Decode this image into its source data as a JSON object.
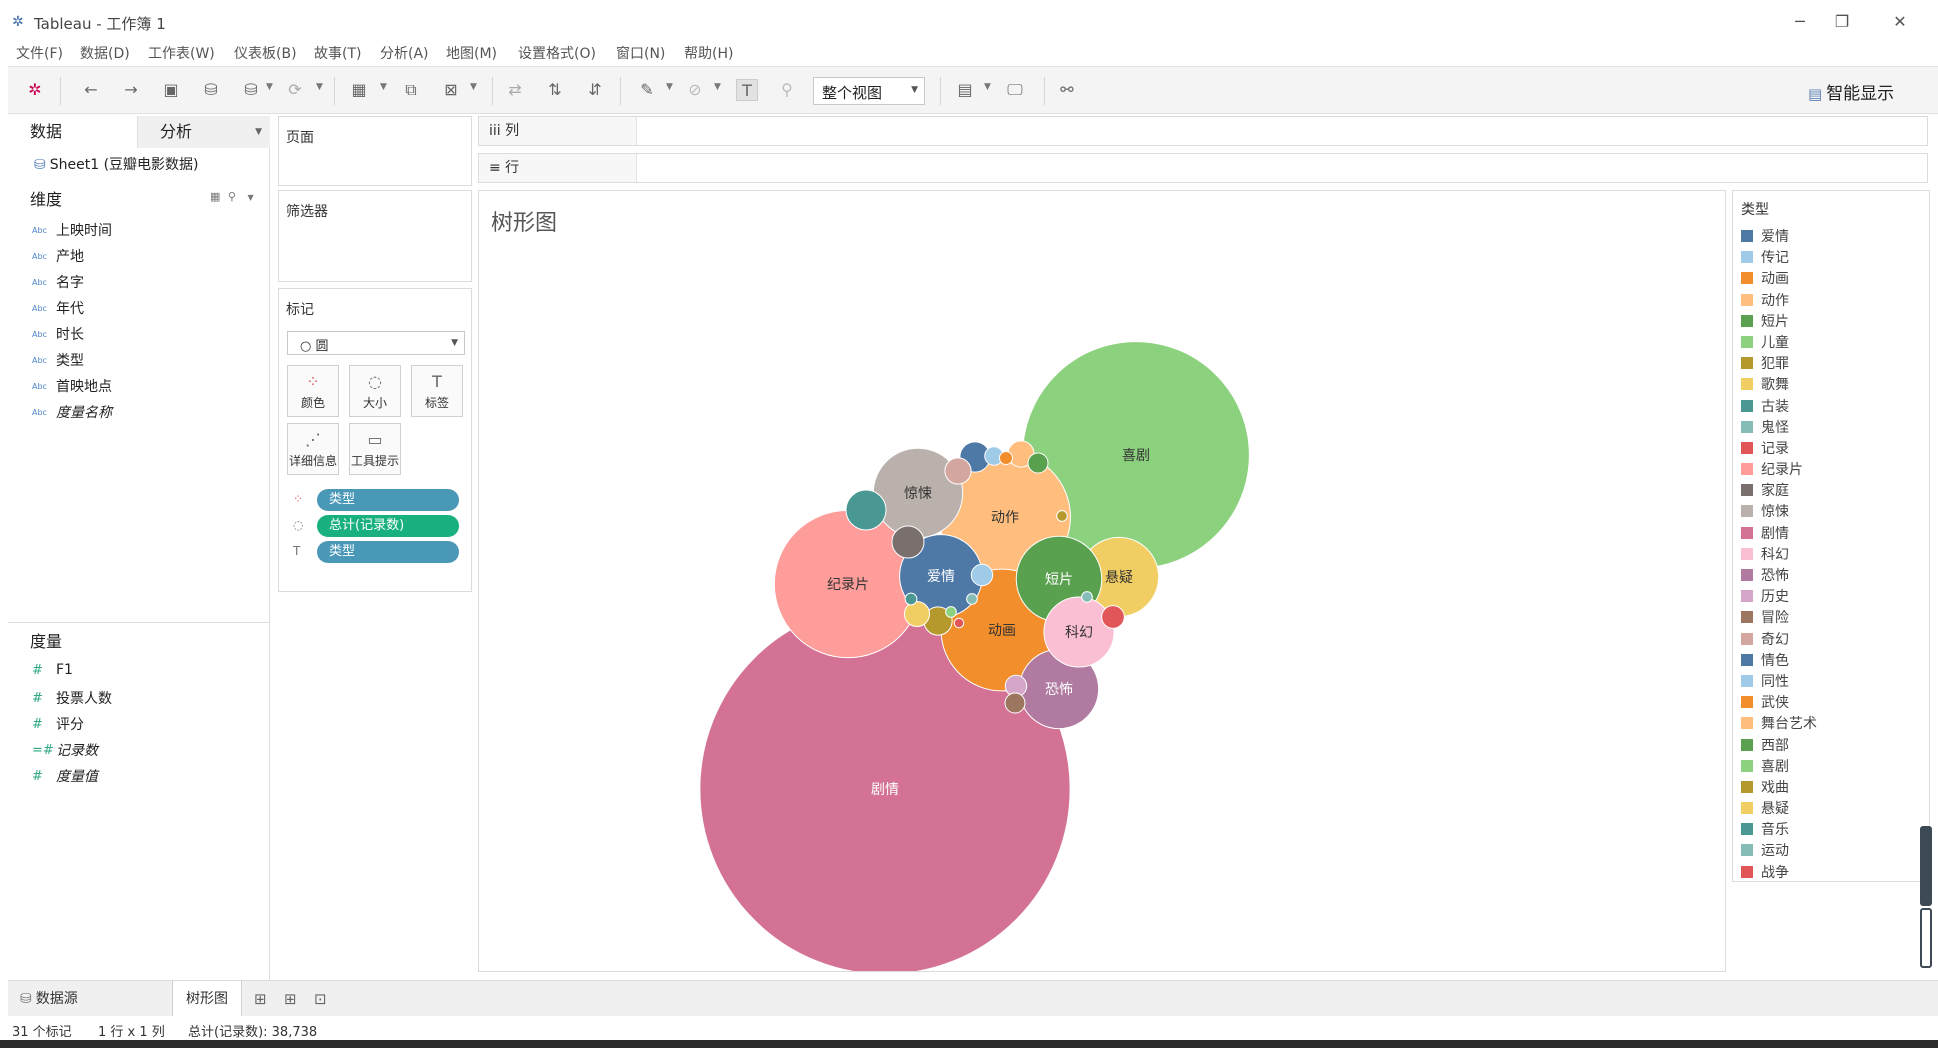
{
  "window": {
    "title": "Tableau - 工作簿 1",
    "minimize": "─",
    "restore": "❐",
    "close": "✕"
  },
  "menu": [
    "文件(F)",
    "数据(D)",
    "工作表(W)",
    "仪表板(B)",
    "故事(T)",
    "分析(A)",
    "地图(M)",
    "设置格式(O)",
    "窗口(N)",
    "帮助(H)"
  ],
  "toolbar": {
    "view_mode": "整个视图",
    "smart_show": "智能显示"
  },
  "data_pane": {
    "tab_data": "数据",
    "tab_analysis": "分析",
    "datasource": "Sheet1 (豆瓣电影数据)",
    "dimensions_header": "维度",
    "dimensions": [
      {
        "type": "Abc",
        "name": "上映时间"
      },
      {
        "type": "Abc",
        "name": "产地"
      },
      {
        "type": "Abc",
        "name": "名字"
      },
      {
        "type": "Abc",
        "name": "年代"
      },
      {
        "type": "Abc",
        "name": "时长"
      },
      {
        "type": "Abc",
        "name": "类型"
      },
      {
        "type": "Abc",
        "name": "首映地点"
      },
      {
        "type": "Abc",
        "name": "度量名称"
      }
    ],
    "measures_header": "度量",
    "measures": [
      {
        "type": "#",
        "name": "F1"
      },
      {
        "type": "#",
        "name": "投票人数"
      },
      {
        "type": "#",
        "name": "评分"
      },
      {
        "type": "=#",
        "name": "记录数"
      },
      {
        "type": "#",
        "name": "度量值"
      }
    ]
  },
  "cards": {
    "pages": "页面",
    "filters": "筛选器",
    "marks": "标记",
    "mark_type": "○ 圆",
    "mark_buttons": [
      {
        "label": "颜色",
        "icon": "⁘"
      },
      {
        "label": "大小",
        "icon": "◌"
      },
      {
        "label": "标签",
        "icon": "T"
      },
      {
        "label": "详细信息",
        "icon": "⋰"
      },
      {
        "label": "工具提示",
        "icon": "▭"
      }
    ],
    "pills": [
      {
        "icon": "⁘",
        "label": "类型",
        "color": "#4a98b8"
      },
      {
        "icon": "◌",
        "label": "总计(记录数)",
        "color": "#18b07f"
      },
      {
        "icon": "T",
        "label": "类型",
        "color": "#4a98b8"
      }
    ]
  },
  "shelves": {
    "columns": "iii 列",
    "rows": "≡ 行"
  },
  "viz": {
    "title": "树形图"
  },
  "chart_data": {
    "type": "packed-bubble",
    "title": "树形图",
    "size_measure": "总计(记录数)",
    "color_dimension": "类型",
    "bubbles": [
      {
        "label": "剧情",
        "color": "#d37295",
        "size": 12000
      },
      {
        "label": "喜剧",
        "color": "#8cd17d",
        "size": 4500
      },
      {
        "label": "纪录片",
        "color": "#ff9d9a",
        "size": 1900
      },
      {
        "label": "动作",
        "color": "#ffbe7d",
        "size": 1500
      },
      {
        "label": "动画",
        "color": "#f28e2b",
        "size": 1300
      },
      {
        "label": "惊悚",
        "color": "#bab0ac",
        "size": 700
      },
      {
        "label": "爱情",
        "color": "#4e79a7",
        "size": 600
      },
      {
        "label": "恐怖",
        "color": "#b07aa1",
        "size": 550
      },
      {
        "label": "悬疑",
        "color": "#f1ce63",
        "size": 550
      },
      {
        "label": "短片",
        "color": "#59a14f",
        "size": 640
      },
      {
        "label": "科幻",
        "color": "#fabfd2",
        "size": 430
      },
      {
        "label": "古装",
        "color": "#499894",
        "size": 140
      },
      {
        "label": "家庭",
        "color": "#79706e",
        "size": 90
      },
      {
        "label": "情色",
        "color": "#4e79a7",
        "size": 80
      },
      {
        "label": "奇幻",
        "color": "#d4a6a0",
        "size": 60
      },
      {
        "label": "舞台艺术",
        "color": "#ffbe7d",
        "size": 60
      },
      {
        "label": "西部",
        "color": "#59a14f",
        "size": 35
      },
      {
        "label": "同性",
        "color": "#a0cbe8",
        "size": 40
      },
      {
        "label": "戏曲",
        "color": "#b6992d",
        "size": 70
      },
      {
        "label": "歌舞",
        "color": "#f1ce63",
        "size": 55
      },
      {
        "label": "历史",
        "color": "#d4a6c8",
        "size": 40
      },
      {
        "label": "冒险",
        "color": "#9d7660",
        "size": 35
      },
      {
        "label": "记录",
        "color": "#e15759",
        "size": 45
      },
      {
        "label": "传记",
        "color": "#a0cbe8",
        "size": 30
      },
      {
        "label": "武侠",
        "color": "#f28e2b",
        "size": 15
      },
      {
        "label": "犯罪",
        "color": "#b6992d",
        "size": 10
      },
      {
        "label": "儿童",
        "color": "#8cd17d",
        "size": 10
      },
      {
        "label": "音乐",
        "color": "#499894",
        "size": 12
      },
      {
        "label": "运动",
        "color": "#86bcb6",
        "size": 10
      },
      {
        "label": "鬼怪",
        "color": "#86bcb6",
        "size": 10
      },
      {
        "label": "战争",
        "color": "#e15759",
        "size": 8
      }
    ]
  },
  "legend": {
    "title": "类型",
    "items": [
      {
        "label": "爱情",
        "color": "#4e79a7"
      },
      {
        "label": "传记",
        "color": "#a0cbe8"
      },
      {
        "label": "动画",
        "color": "#f28e2b"
      },
      {
        "label": "动作",
        "color": "#ffbe7d"
      },
      {
        "label": "短片",
        "color": "#59a14f"
      },
      {
        "label": "儿童",
        "color": "#8cd17d"
      },
      {
        "label": "犯罪",
        "color": "#b6992d"
      },
      {
        "label": "歌舞",
        "color": "#f1ce63"
      },
      {
        "label": "古装",
        "color": "#499894"
      },
      {
        "label": "鬼怪",
        "color": "#86bcb6"
      },
      {
        "label": "记录",
        "color": "#e15759"
      },
      {
        "label": "纪录片",
        "color": "#ff9d9a"
      },
      {
        "label": "家庭",
        "color": "#79706e"
      },
      {
        "label": "惊悚",
        "color": "#bab0ac"
      },
      {
        "label": "剧情",
        "color": "#d37295"
      },
      {
        "label": "科幻",
        "color": "#fabfd2"
      },
      {
        "label": "恐怖",
        "color": "#b07aa1"
      },
      {
        "label": "历史",
        "color": "#d4a6c8"
      },
      {
        "label": "冒险",
        "color": "#9d7660"
      },
      {
        "label": "奇幻",
        "color": "#d4a6a0"
      },
      {
        "label": "情色",
        "color": "#4e79a7"
      },
      {
        "label": "同性",
        "color": "#a0cbe8"
      },
      {
        "label": "武侠",
        "color": "#f28e2b"
      },
      {
        "label": "舞台艺术",
        "color": "#ffbe7d"
      },
      {
        "label": "西部",
        "color": "#59a14f"
      },
      {
        "label": "喜剧",
        "color": "#8cd17d"
      },
      {
        "label": "戏曲",
        "color": "#b6992d"
      },
      {
        "label": "悬疑",
        "color": "#f1ce63"
      },
      {
        "label": "音乐",
        "color": "#499894"
      },
      {
        "label": "运动",
        "color": "#86bcb6"
      },
      {
        "label": "战争",
        "color": "#e15759"
      }
    ]
  },
  "sheet_tabs": {
    "datasource": "数据源",
    "sheet": "树形图"
  },
  "status": {
    "marks": "31 个标记",
    "rowscols": "1 行 x 1 列",
    "total": "总计(记录数): 38,738"
  }
}
